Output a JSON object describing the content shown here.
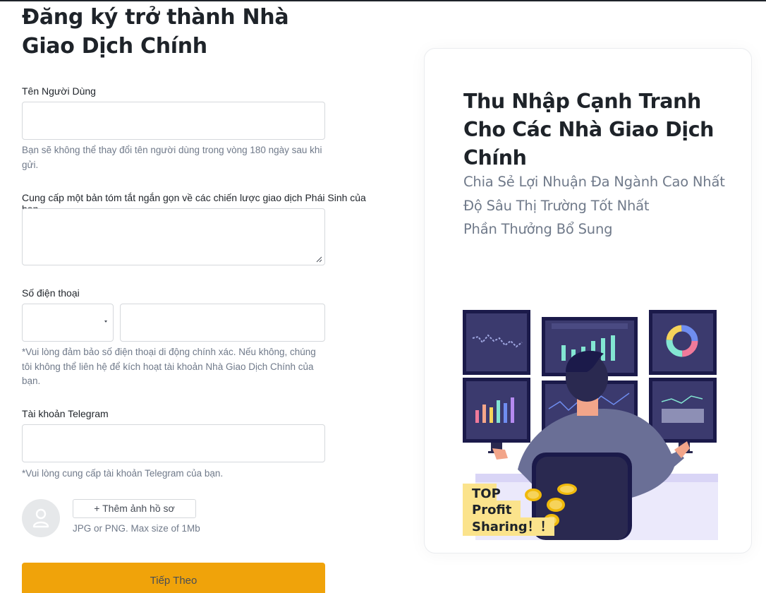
{
  "page": {
    "title": "Đăng ký trở thành Nhà Giao Dịch Chính"
  },
  "form": {
    "username": {
      "label": "Tên Người Dùng",
      "value": "",
      "hint": "Bạn sẽ không thể thay đổi tên người dùng trong vòng 180 ngày sau khi gửi."
    },
    "strategy": {
      "label": "Cung cấp một bản tóm tắt ngắn gọn về các chiến lược giao dịch Phái Sinh của bạn",
      "value": ""
    },
    "phone": {
      "label": "Số điện thoại",
      "country_code": "",
      "value": "",
      "hint": "*Vui lòng đảm bảo số điện thoại di động chính xác. Nếu không, chúng tôi không thể liên hệ để kích hoạt tài khoản Nhà Giao Dịch Chính của bạn."
    },
    "telegram": {
      "label": "Tài khoản Telegram",
      "value": "",
      "hint": "*Vui lòng cung cấp tài khoản Telegram của bạn."
    },
    "avatar": {
      "icon": "user-icon",
      "button_label": "+ Thêm ảnh hồ sơ",
      "hint": "JPG or PNG. Max size of 1Mb"
    },
    "submit_label": "Tiếp Theo"
  },
  "card": {
    "title": "Thu Nhập Cạnh Tranh Cho Các Nhà Giao Dịch Chính",
    "benefits": [
      "Chia Sẻ Lợi Nhuận Đa Ngành Cao Nhất",
      "Độ Sâu Thị Trường Tốt Nhất",
      "Phần Thưởng Bổ Sung"
    ],
    "badge_lines": [
      "TOP",
      "Profit",
      "Sharing！！"
    ]
  },
  "colors": {
    "accent": "#f0a30a",
    "text_primary": "#1e2329",
    "text_secondary": "#707a8a",
    "border": "#d5d8dc",
    "monitor_frame": "#1b1a4a",
    "badge": "#fbe38c"
  }
}
